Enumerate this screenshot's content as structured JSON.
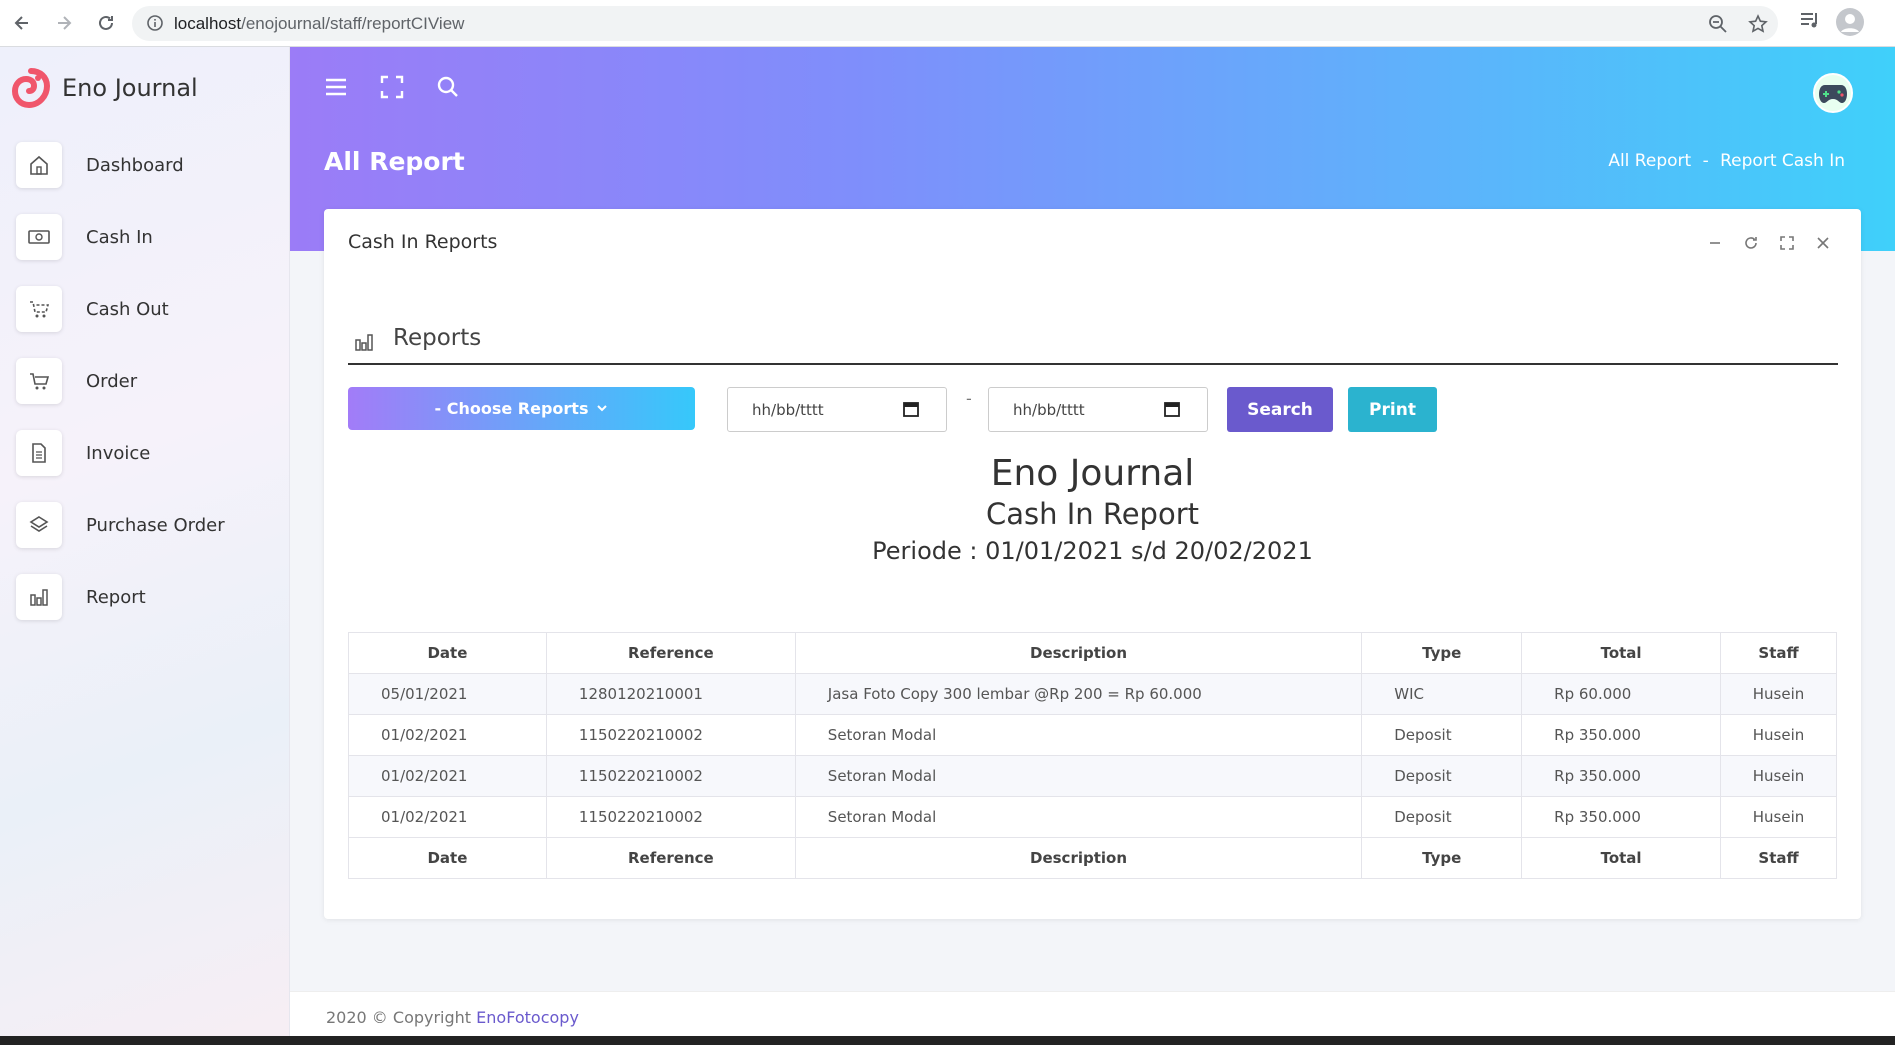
{
  "browser": {
    "url_host": "localhost",
    "url_path": "/enojournal/staff/reportCIView"
  },
  "sidebar": {
    "app_name": "Eno Journal",
    "items": [
      {
        "label": "Dashboard",
        "icon": "home-icon"
      },
      {
        "label": "Cash In",
        "icon": "money-icon"
      },
      {
        "label": "Cash Out",
        "icon": "cart-icon"
      },
      {
        "label": "Order",
        "icon": "cart-icon"
      },
      {
        "label": "Invoice",
        "icon": "document-icon"
      },
      {
        "label": "Purchase Order",
        "icon": "layers-icon"
      },
      {
        "label": "Report",
        "icon": "bar-chart-icon"
      }
    ]
  },
  "header": {
    "page_title": "All Report",
    "breadcrumb": [
      "All Report",
      "-",
      "Report Cash In"
    ]
  },
  "card": {
    "title": "Cash In Reports",
    "section_label": "Reports",
    "choose_label": "- Choose Reports",
    "date_placeholder_from": "hh/bb/tttt",
    "date_separator": "-",
    "date_placeholder_to": "hh/bb/tttt",
    "search_label": "Search",
    "print_label": "Print"
  },
  "report": {
    "company": "Eno Journal",
    "title": "Cash In Report",
    "period": "Periode : 01/01/2021 s/d 20/02/2021"
  },
  "table": {
    "columns": [
      "Date",
      "Reference",
      "Description",
      "Type",
      "Total",
      "Staff"
    ],
    "rows": [
      [
        "05/01/2021",
        "1280120210001",
        "Jasa Foto Copy 300 lembar @Rp 200 = Rp 60.000",
        "WIC",
        "Rp 60.000",
        "Husein"
      ],
      [
        "01/02/2021",
        "1150220210002",
        "Setoran Modal",
        "Deposit",
        "Rp 350.000",
        "Husein"
      ],
      [
        "01/02/2021",
        "1150220210002",
        "Setoran Modal",
        "Deposit",
        "Rp 350.000",
        "Husein"
      ],
      [
        "01/02/2021",
        "1150220210002",
        "Setoran Modal",
        "Deposit",
        "Rp 350.000",
        "Husein"
      ]
    ]
  },
  "footer": {
    "text": "2020 © Copyright",
    "link": "EnoFotocopy"
  },
  "colors": {
    "header_gradient_start": "#9b7cf7",
    "header_gradient_end": "#3fd0fa",
    "search_button": "#6a5acd",
    "print_button": "#2bb3cf"
  }
}
